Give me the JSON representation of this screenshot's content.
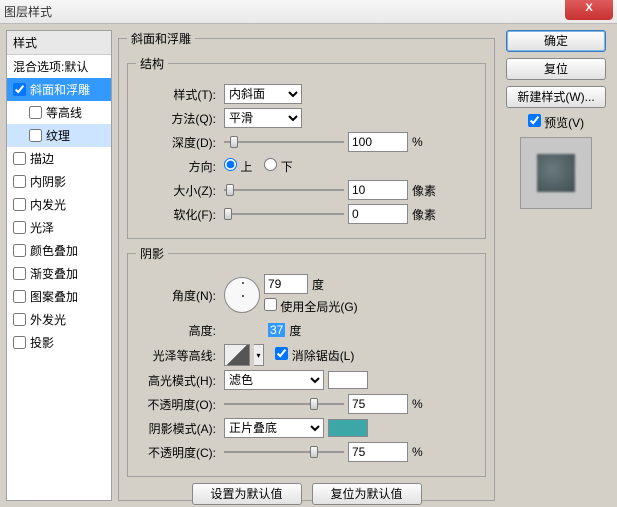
{
  "window": {
    "title": "图层样式",
    "close": "X"
  },
  "sidebar": {
    "header": "样式",
    "blend": "混合选项:默认",
    "items": [
      {
        "label": "斜面和浮雕",
        "checked": true,
        "selected": true
      },
      {
        "label": "等高线",
        "checked": false,
        "sub": true
      },
      {
        "label": "纹理",
        "checked": false,
        "sub": true,
        "highlight": true
      },
      {
        "label": "描边",
        "checked": false
      },
      {
        "label": "内阴影",
        "checked": false
      },
      {
        "label": "内发光",
        "checked": false
      },
      {
        "label": "光泽",
        "checked": false
      },
      {
        "label": "颜色叠加",
        "checked": false
      },
      {
        "label": "渐变叠加",
        "checked": false
      },
      {
        "label": "图案叠加",
        "checked": false
      },
      {
        "label": "外发光",
        "checked": false
      },
      {
        "label": "投影",
        "checked": false
      }
    ]
  },
  "panel": {
    "title": "斜面和浮雕",
    "struct": {
      "legend": "结构",
      "style_lbl": "样式(T):",
      "style_val": "内斜面",
      "method_lbl": "方法(Q):",
      "method_val": "平滑",
      "depth_lbl": "深度(D):",
      "depth_val": "100",
      "pct": "%",
      "dir_lbl": "方向:",
      "dir_up": "上",
      "dir_down": "下",
      "size_lbl": "大小(Z):",
      "size_val": "10",
      "px": "像素",
      "soft_lbl": "软化(F):",
      "soft_val": "0"
    },
    "shade": {
      "legend": "阴影",
      "angle_lbl": "角度(N):",
      "angle_val": "79",
      "deg": "度",
      "global_lbl": "使用全局光(G)",
      "alt_lbl": "高度:",
      "alt_val": "37",
      "gloss_lbl": "光泽等高线:",
      "aa_lbl": "消除锯齿(L)",
      "hi_mode_lbl": "高光模式(H):",
      "hi_mode_val": "滤色",
      "opac_lbl": "不透明度(O):",
      "hi_opac": "75",
      "sh_mode_lbl": "阴影模式(A):",
      "sh_mode_val": "正片叠底",
      "sh_color": "#3da6a6",
      "opac2_lbl": "不透明度(C):",
      "sh_opac": "75"
    },
    "defaults": {
      "set": "设置为默认值",
      "reset": "复位为默认值"
    }
  },
  "right": {
    "ok": "确定",
    "cancel": "复位",
    "newstyle": "新建样式(W)...",
    "preview": "预览(V)"
  }
}
